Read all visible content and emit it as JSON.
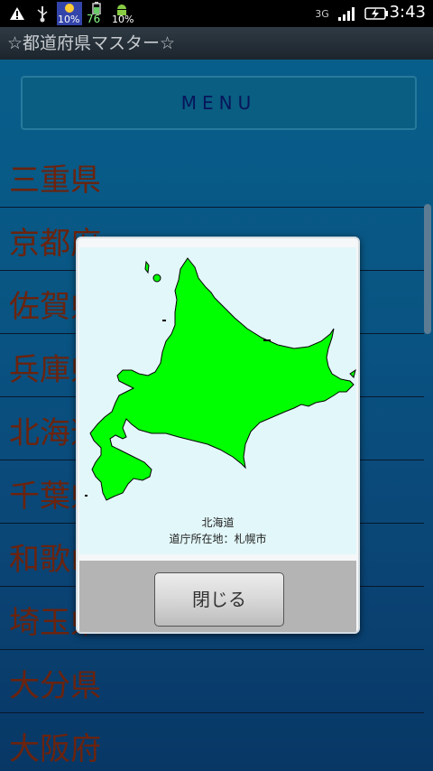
{
  "status_bar": {
    "icons": [
      "warning-icon",
      "usb-icon",
      "weather-widget-icon",
      "battery-widget-icon",
      "android-widget-icon",
      "3g-icon",
      "signal-icon",
      "battery-charging-icon"
    ],
    "weather_percent": "10%",
    "battery_widget_value": "76",
    "android_widget_percent": "10%",
    "network_type": "3G",
    "time": "3:43"
  },
  "title_bar": {
    "title": "☆都道府県マスター☆"
  },
  "menu": {
    "label": "MENU"
  },
  "prefecture_list": {
    "items": [
      "三重県",
      "京都府",
      "佐賀県",
      "兵庫県",
      "北海道",
      "千葉県",
      "和歌山県",
      "埼玉県",
      "大分県",
      "大阪府"
    ]
  },
  "dialog": {
    "map_icon": "hokkaido-map-icon",
    "map_color": "#00ff00",
    "prefecture_name": "北海道",
    "capital_line": "道庁所在地：札幌市",
    "close_label": "閉じる"
  }
}
